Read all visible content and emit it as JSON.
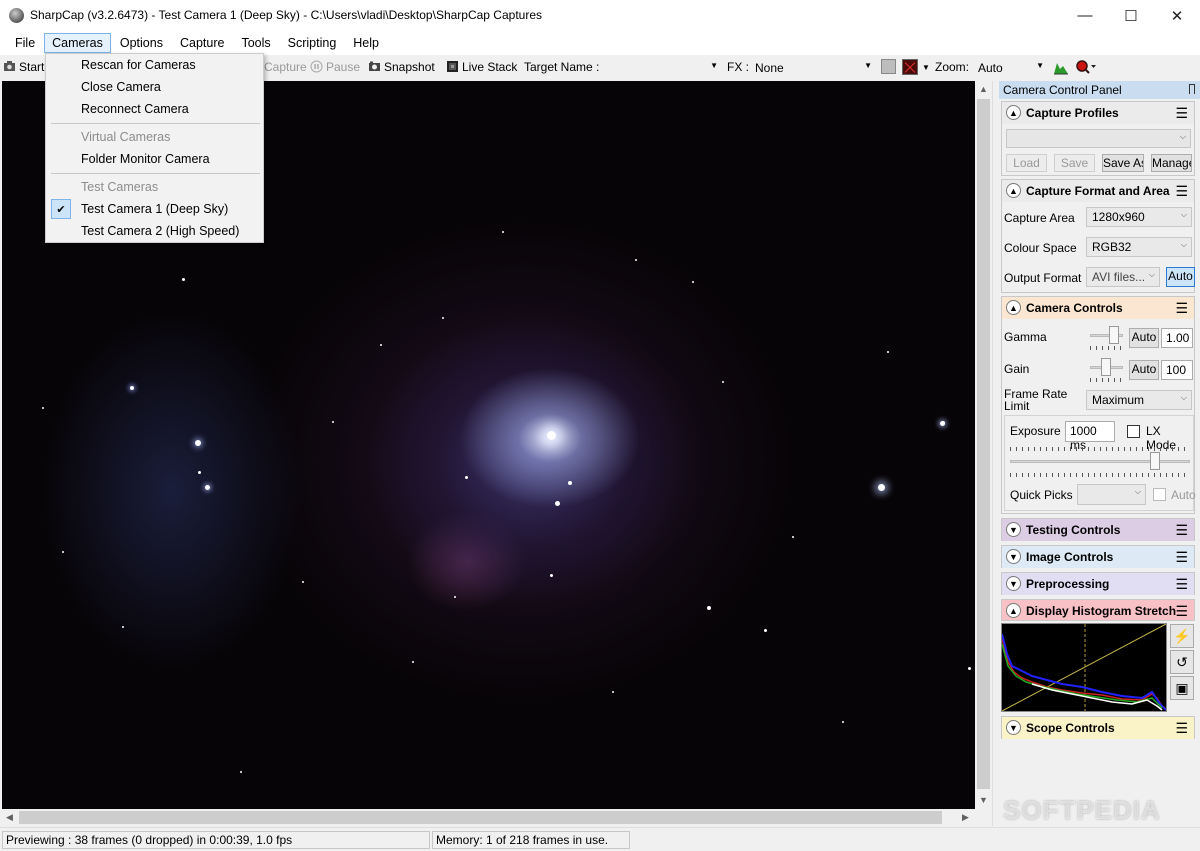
{
  "window": {
    "title": "SharpCap (v3.2.6473) - Test Camera 1 (Deep Sky) - C:\\Users\\vladi\\Desktop\\SharpCap Captures",
    "minimize": "—",
    "maximize": "☐",
    "close": "✕"
  },
  "menubar": [
    "File",
    "Cameras",
    "Options",
    "Capture",
    "Tools",
    "Scripting",
    "Help"
  ],
  "toolbar": {
    "start": "Start",
    "capture": "Capture",
    "pause": "Pause",
    "snapshot": "Snapshot",
    "live_stack": "Live Stack",
    "target_name_label": "Target Name :",
    "target_name_value": "",
    "fx_label": "FX :",
    "fx_value": "None",
    "zoom_label": "Zoom:",
    "zoom_value": "Auto"
  },
  "cameras_menu": {
    "items": [
      {
        "label": "Rescan for Cameras",
        "enabled": true
      },
      {
        "label": "Close Camera",
        "enabled": true
      },
      {
        "label": "Reconnect Camera",
        "enabled": true
      },
      {
        "label": "Virtual Cameras",
        "enabled": false
      },
      {
        "label": "Folder Monitor Camera",
        "enabled": true
      },
      {
        "label": "Test Cameras",
        "enabled": false
      },
      {
        "label": "Test Camera 1 (Deep Sky)",
        "enabled": true,
        "checked": true
      },
      {
        "label": "Test Camera 2 (High Speed)",
        "enabled": true
      }
    ],
    "check_mark": "✔"
  },
  "panel": {
    "title": "Camera Control Panel",
    "pin_icon": "pin-icon",
    "capture_profiles": {
      "title": "Capture Profiles",
      "profile_value": "",
      "load": "Load",
      "save": "Save",
      "save_as": "Save As",
      "manage": "Manage"
    },
    "capture_format": {
      "title": "Capture Format and Area",
      "capture_area_label": "Capture Area",
      "capture_area_value": "1280x960",
      "colour_space_label": "Colour Space",
      "colour_space_value": "RGB32",
      "output_format_label": "Output Format",
      "output_format_value": "AVI files...",
      "auto": "Auto"
    },
    "camera_controls": {
      "title": "Camera Controls",
      "gamma_label": "Gamma",
      "gamma_auto": "Auto",
      "gamma_value": "1.00",
      "gain_label": "Gain",
      "gain_auto": "Auto",
      "gain_value": "100",
      "frame_rate_label_1": "Frame Rate",
      "frame_rate_label_2": "Limit",
      "frame_rate_value": "Maximum",
      "exposure_label": "Exposure",
      "exposure_value": "1000 ms",
      "lx_mode": "LX Mode",
      "quick_picks_label": "Quick Picks",
      "quick_picks_value": "",
      "quick_picks_auto": "Auto"
    },
    "testing_controls": {
      "title": "Testing Controls"
    },
    "image_controls": {
      "title": "Image Controls"
    },
    "preprocessing": {
      "title": "Preprocessing"
    },
    "histogram_stretch": {
      "title": "Display Histogram Stretch"
    },
    "scope_controls": {
      "title": "Scope Controls"
    },
    "section_colors": {
      "capture_profiles": "#ebebeb",
      "capture_format": "#ebebeb",
      "camera_controls": "#fbe7d1",
      "testing_controls": "#dccde5",
      "image_controls": "#dde9f5",
      "preprocessing": "#e1def4",
      "histogram_stretch": "#f7c1c6",
      "scope_controls": "#fbf3c8"
    }
  },
  "statusbar": {
    "preview": "Previewing : 38 frames (0 dropped) in 0:00:39, 1.0 fps",
    "memory": "Memory: 1 of 218 frames in use."
  },
  "watermark": "SOFTPEDIA"
}
